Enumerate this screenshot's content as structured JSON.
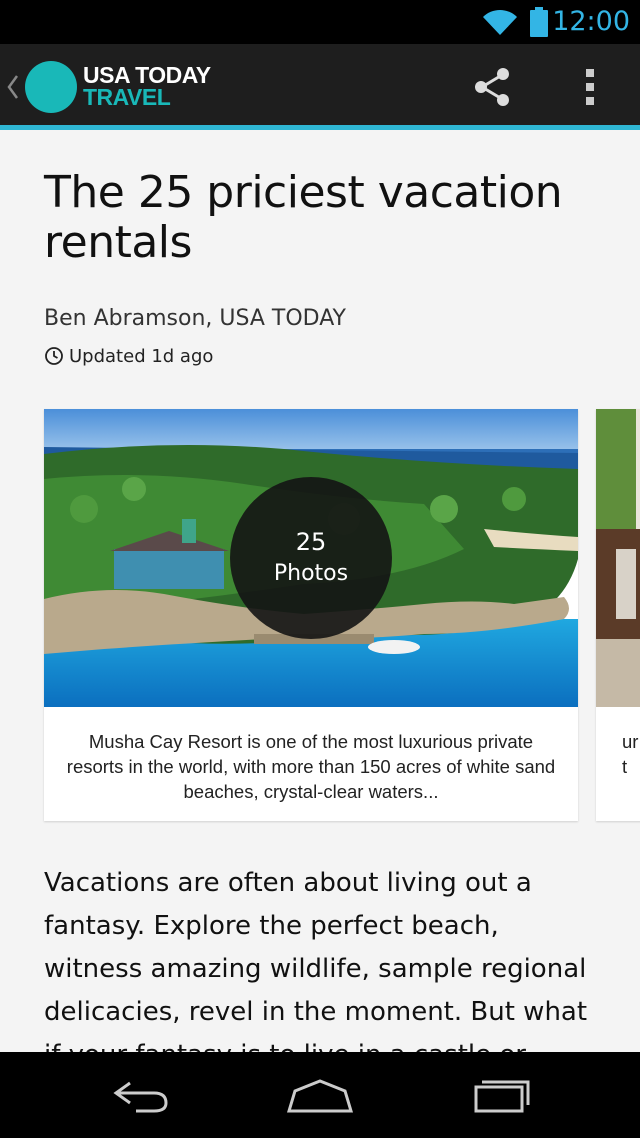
{
  "status_bar": {
    "time": "12:00",
    "icons": [
      "wifi-icon",
      "battery-icon"
    ],
    "clock_color": "#33b5e5"
  },
  "app_bar": {
    "logo_line1": "USA TODAY",
    "logo_line2": "TRAVEL",
    "brand_color": "#19b8b8",
    "accent_color": "#2fb6d3",
    "icons": [
      "chevron-left-icon",
      "share-icon",
      "overflow-menu-icon"
    ]
  },
  "article": {
    "headline": "The 25 priciest vacation rentals",
    "byline": "Ben Abramson, USA TODAY",
    "updated": "Updated 1d ago",
    "body": "Vacations are often about living out a fantasy. Explore the perfect beach, witness amazing wildlife, sample regional delicacies, revel in the moment. But what if your fantasy is to live in a castle or inhabit"
  },
  "gallery": {
    "photo_count": "25",
    "photo_label": "Photos",
    "caption": "Musha Cay Resort is one of the most luxurious private resorts in the world, with more than 150 acres of white sand beaches, crystal-clear waters...",
    "next_caption_partial": "ur\nt"
  },
  "nav_bar": {
    "icons": [
      "back-icon",
      "home-icon",
      "recent-apps-icon"
    ]
  }
}
